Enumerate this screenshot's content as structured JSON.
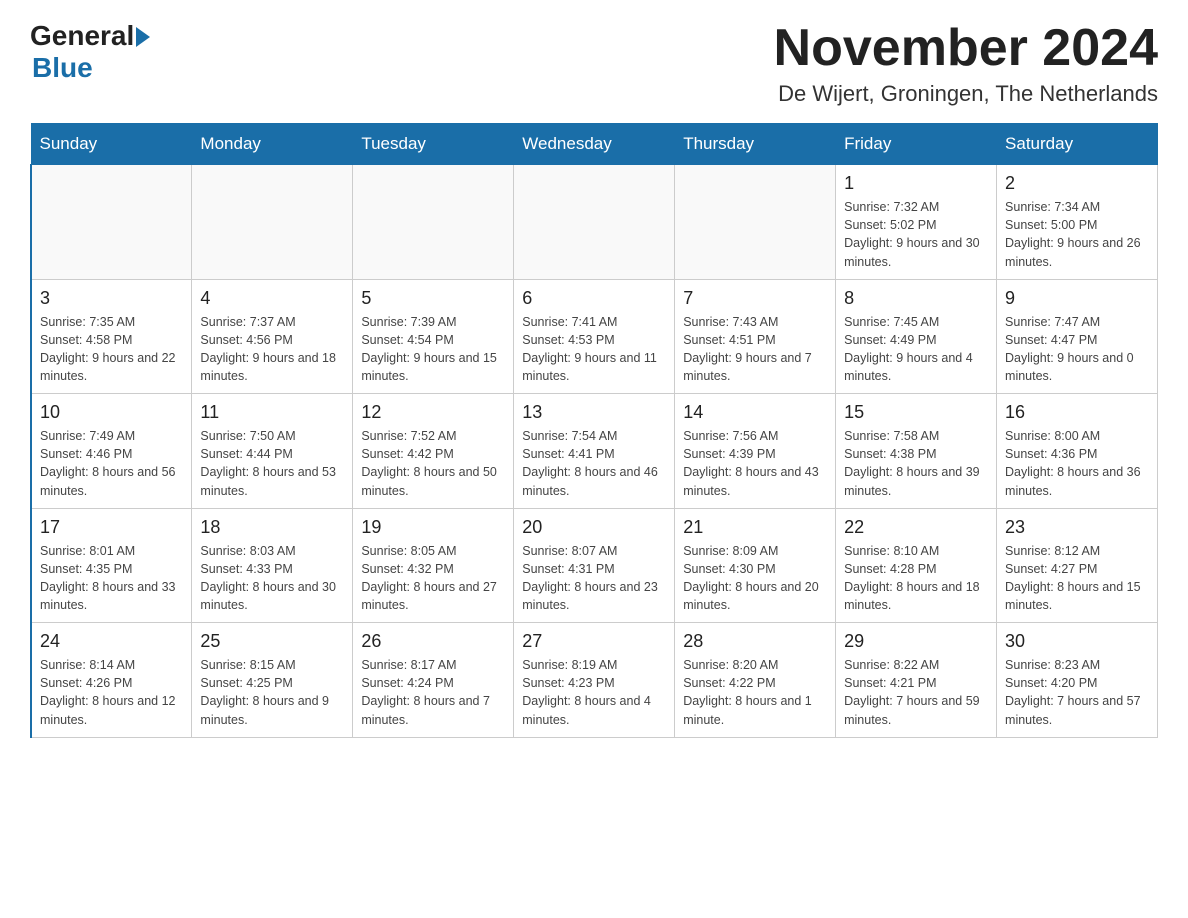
{
  "header": {
    "logo_general": "General",
    "logo_blue": "Blue",
    "month_title": "November 2024",
    "location": "De Wijert, Groningen, The Netherlands"
  },
  "days_of_week": [
    "Sunday",
    "Monday",
    "Tuesday",
    "Wednesday",
    "Thursday",
    "Friday",
    "Saturday"
  ],
  "weeks": [
    [
      {
        "day": "",
        "sunrise": "",
        "sunset": "",
        "daylight": "",
        "empty": true
      },
      {
        "day": "",
        "sunrise": "",
        "sunset": "",
        "daylight": "",
        "empty": true
      },
      {
        "day": "",
        "sunrise": "",
        "sunset": "",
        "daylight": "",
        "empty": true
      },
      {
        "day": "",
        "sunrise": "",
        "sunset": "",
        "daylight": "",
        "empty": true
      },
      {
        "day": "",
        "sunrise": "",
        "sunset": "",
        "daylight": "",
        "empty": true
      },
      {
        "day": "1",
        "sunrise": "Sunrise: 7:32 AM",
        "sunset": "Sunset: 5:02 PM",
        "daylight": "Daylight: 9 hours and 30 minutes.",
        "empty": false
      },
      {
        "day": "2",
        "sunrise": "Sunrise: 7:34 AM",
        "sunset": "Sunset: 5:00 PM",
        "daylight": "Daylight: 9 hours and 26 minutes.",
        "empty": false
      }
    ],
    [
      {
        "day": "3",
        "sunrise": "Sunrise: 7:35 AM",
        "sunset": "Sunset: 4:58 PM",
        "daylight": "Daylight: 9 hours and 22 minutes.",
        "empty": false
      },
      {
        "day": "4",
        "sunrise": "Sunrise: 7:37 AM",
        "sunset": "Sunset: 4:56 PM",
        "daylight": "Daylight: 9 hours and 18 minutes.",
        "empty": false
      },
      {
        "day": "5",
        "sunrise": "Sunrise: 7:39 AM",
        "sunset": "Sunset: 4:54 PM",
        "daylight": "Daylight: 9 hours and 15 minutes.",
        "empty": false
      },
      {
        "day": "6",
        "sunrise": "Sunrise: 7:41 AM",
        "sunset": "Sunset: 4:53 PM",
        "daylight": "Daylight: 9 hours and 11 minutes.",
        "empty": false
      },
      {
        "day": "7",
        "sunrise": "Sunrise: 7:43 AM",
        "sunset": "Sunset: 4:51 PM",
        "daylight": "Daylight: 9 hours and 7 minutes.",
        "empty": false
      },
      {
        "day": "8",
        "sunrise": "Sunrise: 7:45 AM",
        "sunset": "Sunset: 4:49 PM",
        "daylight": "Daylight: 9 hours and 4 minutes.",
        "empty": false
      },
      {
        "day": "9",
        "sunrise": "Sunrise: 7:47 AM",
        "sunset": "Sunset: 4:47 PM",
        "daylight": "Daylight: 9 hours and 0 minutes.",
        "empty": false
      }
    ],
    [
      {
        "day": "10",
        "sunrise": "Sunrise: 7:49 AM",
        "sunset": "Sunset: 4:46 PM",
        "daylight": "Daylight: 8 hours and 56 minutes.",
        "empty": false
      },
      {
        "day": "11",
        "sunrise": "Sunrise: 7:50 AM",
        "sunset": "Sunset: 4:44 PM",
        "daylight": "Daylight: 8 hours and 53 minutes.",
        "empty": false
      },
      {
        "day": "12",
        "sunrise": "Sunrise: 7:52 AM",
        "sunset": "Sunset: 4:42 PM",
        "daylight": "Daylight: 8 hours and 50 minutes.",
        "empty": false
      },
      {
        "day": "13",
        "sunrise": "Sunrise: 7:54 AM",
        "sunset": "Sunset: 4:41 PM",
        "daylight": "Daylight: 8 hours and 46 minutes.",
        "empty": false
      },
      {
        "day": "14",
        "sunrise": "Sunrise: 7:56 AM",
        "sunset": "Sunset: 4:39 PM",
        "daylight": "Daylight: 8 hours and 43 minutes.",
        "empty": false
      },
      {
        "day": "15",
        "sunrise": "Sunrise: 7:58 AM",
        "sunset": "Sunset: 4:38 PM",
        "daylight": "Daylight: 8 hours and 39 minutes.",
        "empty": false
      },
      {
        "day": "16",
        "sunrise": "Sunrise: 8:00 AM",
        "sunset": "Sunset: 4:36 PM",
        "daylight": "Daylight: 8 hours and 36 minutes.",
        "empty": false
      }
    ],
    [
      {
        "day": "17",
        "sunrise": "Sunrise: 8:01 AM",
        "sunset": "Sunset: 4:35 PM",
        "daylight": "Daylight: 8 hours and 33 minutes.",
        "empty": false
      },
      {
        "day": "18",
        "sunrise": "Sunrise: 8:03 AM",
        "sunset": "Sunset: 4:33 PM",
        "daylight": "Daylight: 8 hours and 30 minutes.",
        "empty": false
      },
      {
        "day": "19",
        "sunrise": "Sunrise: 8:05 AM",
        "sunset": "Sunset: 4:32 PM",
        "daylight": "Daylight: 8 hours and 27 minutes.",
        "empty": false
      },
      {
        "day": "20",
        "sunrise": "Sunrise: 8:07 AM",
        "sunset": "Sunset: 4:31 PM",
        "daylight": "Daylight: 8 hours and 23 minutes.",
        "empty": false
      },
      {
        "day": "21",
        "sunrise": "Sunrise: 8:09 AM",
        "sunset": "Sunset: 4:30 PM",
        "daylight": "Daylight: 8 hours and 20 minutes.",
        "empty": false
      },
      {
        "day": "22",
        "sunrise": "Sunrise: 8:10 AM",
        "sunset": "Sunset: 4:28 PM",
        "daylight": "Daylight: 8 hours and 18 minutes.",
        "empty": false
      },
      {
        "day": "23",
        "sunrise": "Sunrise: 8:12 AM",
        "sunset": "Sunset: 4:27 PM",
        "daylight": "Daylight: 8 hours and 15 minutes.",
        "empty": false
      }
    ],
    [
      {
        "day": "24",
        "sunrise": "Sunrise: 8:14 AM",
        "sunset": "Sunset: 4:26 PM",
        "daylight": "Daylight: 8 hours and 12 minutes.",
        "empty": false
      },
      {
        "day": "25",
        "sunrise": "Sunrise: 8:15 AM",
        "sunset": "Sunset: 4:25 PM",
        "daylight": "Daylight: 8 hours and 9 minutes.",
        "empty": false
      },
      {
        "day": "26",
        "sunrise": "Sunrise: 8:17 AM",
        "sunset": "Sunset: 4:24 PM",
        "daylight": "Daylight: 8 hours and 7 minutes.",
        "empty": false
      },
      {
        "day": "27",
        "sunrise": "Sunrise: 8:19 AM",
        "sunset": "Sunset: 4:23 PM",
        "daylight": "Daylight: 8 hours and 4 minutes.",
        "empty": false
      },
      {
        "day": "28",
        "sunrise": "Sunrise: 8:20 AM",
        "sunset": "Sunset: 4:22 PM",
        "daylight": "Daylight: 8 hours and 1 minute.",
        "empty": false
      },
      {
        "day": "29",
        "sunrise": "Sunrise: 8:22 AM",
        "sunset": "Sunset: 4:21 PM",
        "daylight": "Daylight: 7 hours and 59 minutes.",
        "empty": false
      },
      {
        "day": "30",
        "sunrise": "Sunrise: 8:23 AM",
        "sunset": "Sunset: 4:20 PM",
        "daylight": "Daylight: 7 hours and 57 minutes.",
        "empty": false
      }
    ]
  ]
}
